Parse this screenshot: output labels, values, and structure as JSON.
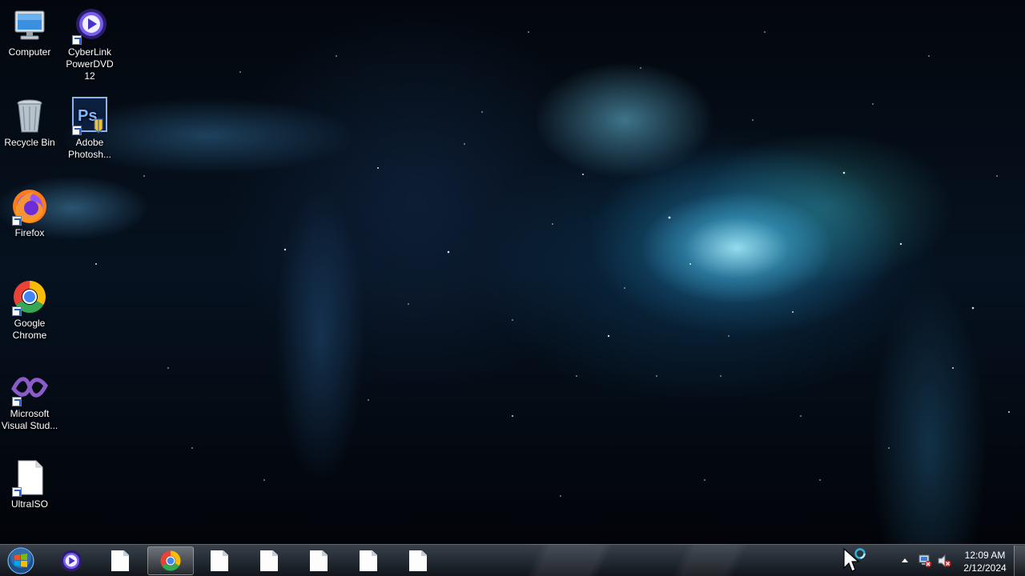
{
  "desktop": {
    "icons": [
      {
        "label": "Computer",
        "icon": "computer-icon"
      },
      {
        "label": "CyberLink PowerDVD 12",
        "icon": "powerdvd-icon"
      },
      {
        "label": "Recycle Bin",
        "icon": "recycle-bin-icon"
      },
      {
        "label": "Adobe Photosh...",
        "icon": "photoshop-icon"
      },
      {
        "label": "Firefox",
        "icon": "firefox-icon"
      },
      {
        "label": "Google Chrome",
        "icon": "chrome-icon"
      },
      {
        "label": "Microsoft Visual Stud...",
        "icon": "visual-studio-icon"
      },
      {
        "label": "UltraISO",
        "icon": "blank-file-icon"
      }
    ]
  },
  "taskbar": {
    "start_icon": "windows-orb-icon",
    "items": [
      {
        "icon": "powerdvd-icon",
        "active": false
      },
      {
        "icon": "blank-file-icon",
        "active": false
      },
      {
        "icon": "chrome-icon",
        "active": true
      },
      {
        "icon": "blank-file-icon",
        "active": false
      },
      {
        "icon": "blank-file-icon",
        "active": false
      },
      {
        "icon": "blank-file-icon",
        "active": false
      },
      {
        "icon": "blank-file-icon",
        "active": false
      },
      {
        "icon": "blank-file-icon",
        "active": false
      }
    ],
    "tray": {
      "icons": [
        "show-hidden-icons-arrow",
        "network-disconnected-icon",
        "volume-muted-icon"
      ],
      "time": "12:09 AM",
      "date": "2/12/2024"
    }
  },
  "colors": {
    "taskbar_bg": "#1c2128",
    "label_text": "#ffffff",
    "nebula_accent": "#5ad8f0"
  }
}
